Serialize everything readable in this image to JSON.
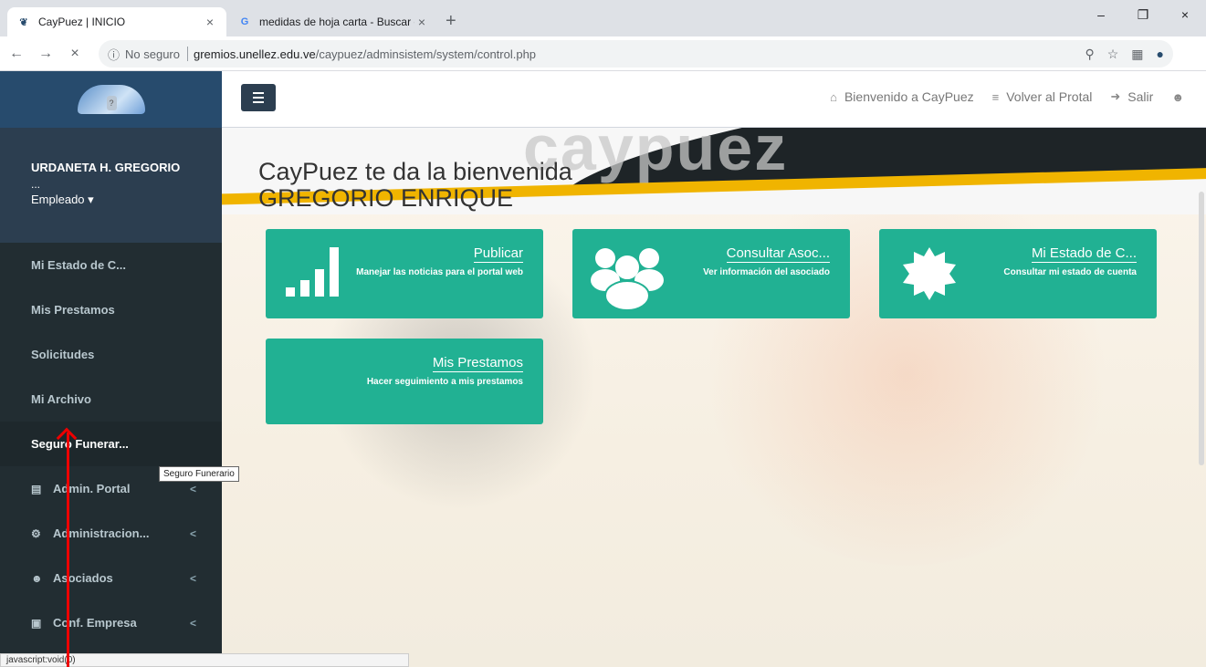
{
  "browser": {
    "tabs": [
      {
        "title": "CayPuez | INICIO",
        "close": "×"
      },
      {
        "title": "medidas de hoja carta - Buscar c",
        "close": "×"
      }
    ],
    "new_tab": "+",
    "window_controls": [
      "–",
      "❐",
      "×"
    ],
    "nav": {
      "back": "←",
      "forward": "→",
      "stop": "×"
    },
    "address": {
      "security_icon": "ⓘ",
      "security": "No seguro",
      "host": "gremios.unellez.edu.ve",
      "path": "/caypuez/adminsistem/system/control.php"
    },
    "status_url": "javascript:void(0)"
  },
  "sidebar": {
    "user_name": "URDANETA H. GREGORIO",
    "user_dots": "...",
    "role": "Empleado ▾",
    "items": [
      {
        "label": "Mi Estado de C..."
      },
      {
        "label": "Mis Prestamos"
      },
      {
        "label": "Solicitudes"
      },
      {
        "label": "Mi Archivo"
      },
      {
        "label": "Seguro Funerar..."
      },
      {
        "label": "Admin. Portal",
        "icon": "newspaper-icon",
        "chev": "<"
      },
      {
        "label": "Administracion...",
        "icon": "gear-icon",
        "chev": "<"
      },
      {
        "label": "Asociados",
        "icon": "users-icon",
        "chev": "<"
      },
      {
        "label": "Conf. Empresa",
        "icon": "briefcase-icon",
        "chev": "<"
      }
    ],
    "tooltip": "Seguro Funerario"
  },
  "topbar": {
    "welcome_link": "Bienvenido a CayPuez",
    "back_portal": "Volver al Protal",
    "logout": "Salir"
  },
  "main": {
    "banner_watermark": "caypuez",
    "welcome_line1": "CayPuez te da la bienvenida",
    "welcome_line2": "GREGORIO ENRIQUE",
    "cards": [
      {
        "title": "Publicar",
        "desc": "Manejar las noticias para el portal web",
        "icon": "signal-bars-icon"
      },
      {
        "title": "Consultar Asoc...",
        "desc": "Ver información del asociado",
        "icon": "users-icon"
      },
      {
        "title": "Mi Estado de C...",
        "desc": "Consultar mi estado de cuenta",
        "icon": "certificate-icon"
      },
      {
        "title": "Mis Prestamos",
        "desc": "Hacer seguimiento a mis prestamos",
        "icon": "none"
      }
    ]
  },
  "colors": {
    "sidebar_bg": "#222d32",
    "sidebar_header": "#274b6d",
    "card": "#21b193",
    "accent_gold": "#f0b400"
  }
}
